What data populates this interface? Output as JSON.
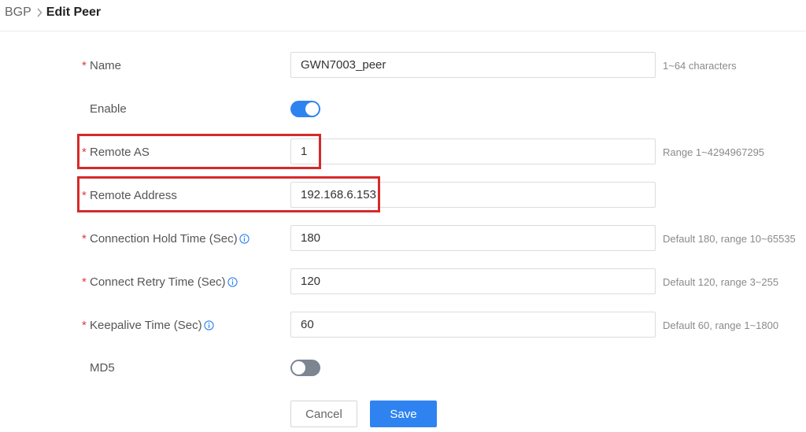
{
  "breadcrumb": {
    "parent": "BGP",
    "current": "Edit Peer"
  },
  "form": {
    "name": {
      "label": "Name",
      "value": "GWN7003_peer",
      "hint": "1~64 characters"
    },
    "enable": {
      "label": "Enable",
      "state": "on"
    },
    "remote_as": {
      "label": "Remote AS",
      "value": "1",
      "hint": "Range 1~4294967295"
    },
    "remote_address": {
      "label": "Remote Address",
      "value": "192.168.6.153"
    },
    "hold_time": {
      "label": "Connection Hold Time (Sec)",
      "value": "180",
      "hint": "Default 180, range 10~65535"
    },
    "retry_time": {
      "label": "Connect Retry Time (Sec)",
      "value": "120",
      "hint": "Default 120, range 3~255"
    },
    "keepalive_time": {
      "label": "Keepalive Time (Sec)",
      "value": "60",
      "hint": "Default 60, range 1~1800"
    },
    "md5": {
      "label": "MD5",
      "state": "off"
    }
  },
  "buttons": {
    "cancel": "Cancel",
    "save": "Save"
  },
  "colors": {
    "accent": "#2f83f0",
    "required": "#e03a3a",
    "highlight": "#d62a2a",
    "toggle_off": "#7c8590"
  },
  "icons": {
    "info": "info-circle-icon",
    "breadcrumb_separator": "chevron-right-icon"
  }
}
